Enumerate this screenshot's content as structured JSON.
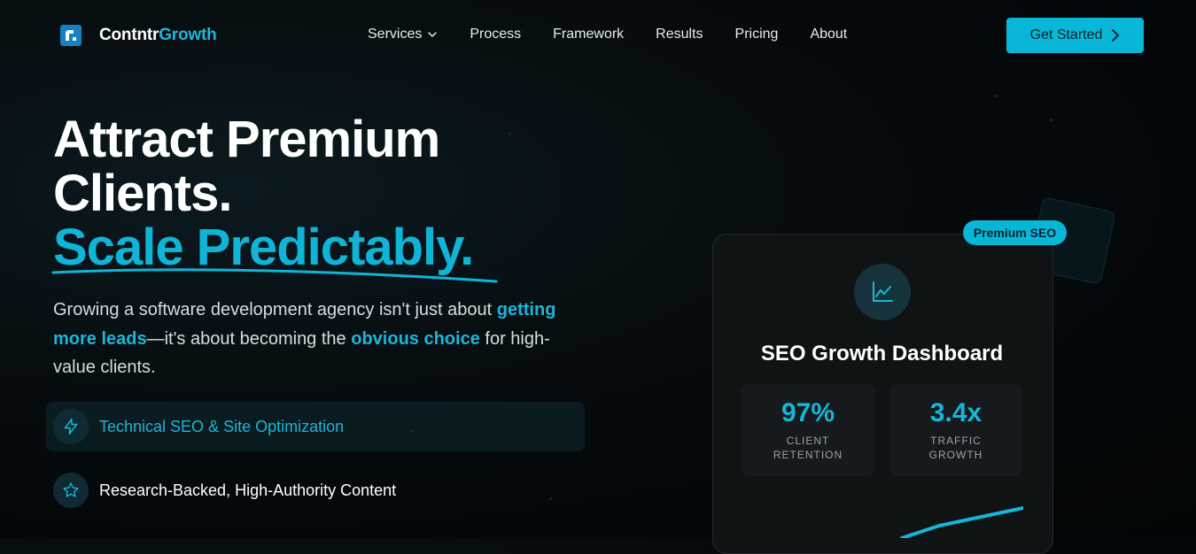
{
  "brand": {
    "name_part1": "Contntr",
    "name_part2": "Growth"
  },
  "nav": {
    "items": [
      {
        "label": "Services",
        "has_dropdown": true
      },
      {
        "label": "Process"
      },
      {
        "label": "Framework"
      },
      {
        "label": "Results"
      },
      {
        "label": "Pricing"
      },
      {
        "label": "About"
      }
    ],
    "cta_label": "Get Started"
  },
  "hero": {
    "headline_line1": "Attract Premium",
    "headline_line2": "Clients.",
    "headline_accent": "Scale Predictably.",
    "lead": {
      "part1": "Growing a software development agency isn't just about ",
      "hl1": "getting more leads",
      "part2": "—it's about becoming the ",
      "hl2": "obvious choice",
      "part3": " for high-value clients."
    },
    "features": [
      {
        "label": "Technical SEO & Site Optimization",
        "icon": "lightning-icon",
        "active": true
      },
      {
        "label": "Research-Backed, High-Authority Content",
        "icon": "star-icon",
        "active": false
      }
    ]
  },
  "dashboard": {
    "badge": "Premium SEO",
    "icon": "line-chart-icon",
    "title": "SEO Growth Dashboard",
    "stats": [
      {
        "value": "97%",
        "caption": "CLIENT RETENTION"
      },
      {
        "value": "3.4x",
        "caption": "TRAFFIC GROWTH"
      }
    ]
  },
  "colors": {
    "accent": "#08b6d8",
    "background": "#060b0e",
    "card": "#101314"
  }
}
